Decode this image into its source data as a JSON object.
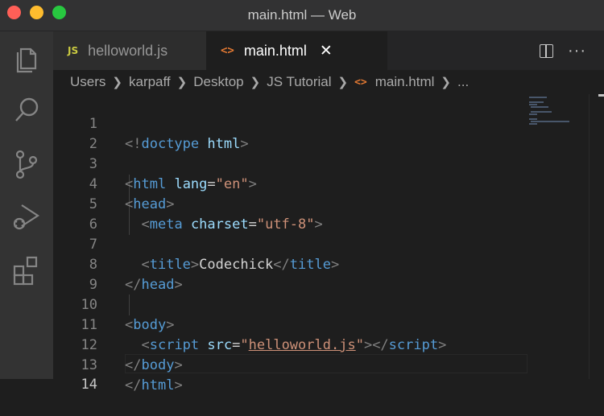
{
  "window": {
    "title": "main.html — Web"
  },
  "activity_bar": {
    "items": [
      {
        "name": "explorer-icon"
      },
      {
        "name": "search-icon"
      },
      {
        "name": "source-control-icon"
      },
      {
        "name": "run-debug-icon"
      },
      {
        "name": "extensions-icon"
      }
    ]
  },
  "tabs": [
    {
      "badge": "JS",
      "label": "helloworld.js",
      "active": false
    },
    {
      "badge": "<>",
      "label": "main.html",
      "active": true,
      "close": "✕"
    }
  ],
  "tab_actions": {
    "more": "···"
  },
  "breadcrumb": {
    "items": [
      "Users",
      "karpaff",
      "Desktop",
      "JS Tutorial"
    ],
    "file_icon": "<>",
    "file": "main.html",
    "more": "..."
  },
  "editor": {
    "line_numbers": [
      "1",
      "2",
      "3",
      "4",
      "5",
      "6",
      "7",
      "8",
      "9",
      "10",
      "11",
      "12",
      "13",
      "14"
    ],
    "current_line": "14",
    "tokens": {
      "l1_open": "<!",
      "l1_doctype": "doctype",
      "l1_html": "html",
      "l1_close": ">",
      "l3_open": "<",
      "l3_tag": "html",
      "l3_attr": "lang",
      "l3_eq": "=",
      "l3_val": "\"en\"",
      "l3_close": ">",
      "l4_open": "<",
      "l4_tag": "head",
      "l4_close": ">",
      "l5_open": "<",
      "l5_tag": "meta",
      "l5_attr": "charset",
      "l5_eq": "=",
      "l5_val": "\"utf-8\"",
      "l5_close": ">",
      "l7_open": "<",
      "l7_tag": "title",
      "l7_close": ">",
      "l7_text": "Codechick",
      "l7_end_open": "</",
      "l7_end_tag": "title",
      "l7_end_close": ">",
      "l8_open": "</",
      "l8_tag": "head",
      "l8_close": ">",
      "l10_open": "<",
      "l10_tag": "body",
      "l10_close": ">",
      "l11_open": "<",
      "l11_tag": "script",
      "l11_attr": "src",
      "l11_eq": "=",
      "l11_q1": "\"",
      "l11_val": "helloworld.js",
      "l11_q2": "\"",
      "l11_close": ">",
      "l11_end_open": "</",
      "l11_end_tag": "script",
      "l11_end_close": ">",
      "l12_open": "</",
      "l12_tag": "body",
      "l12_close": ">",
      "l13_open": "</",
      "l13_tag": "html",
      "l13_close": ">"
    }
  }
}
